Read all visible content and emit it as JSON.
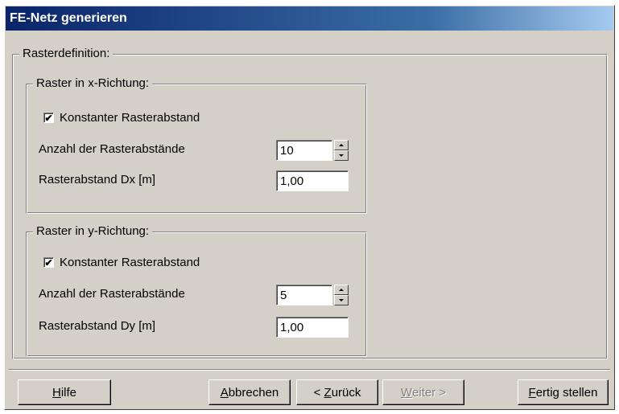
{
  "window": {
    "title": "FE-Netz generieren"
  },
  "raster": {
    "group_label": "Rasterdefinition:",
    "x": {
      "group_label": "Raster in x-Richtung:",
      "constant_checked": true,
      "constant_label": "Konstanter Rasterabstand",
      "count_label": "Anzahl der Rasterabstände",
      "count_value": "10",
      "spacing_label": "Rasterabstand  Dx [m]",
      "spacing_value": "1,00"
    },
    "y": {
      "group_label": "Raster in y-Richtung:",
      "constant_checked": true,
      "constant_label": "Konstanter Rasterabstand",
      "count_label": "Anzahl der Rasterabstände",
      "count_value": "5",
      "spacing_label": "Rasterabstand  Dy [m]",
      "spacing_value": "1,00"
    }
  },
  "buttons": {
    "help": {
      "mnemonic": "H",
      "rest": "ilfe"
    },
    "cancel": {
      "mnemonic": "A",
      "rest": "bbrechen"
    },
    "back": {
      "prefix": "< ",
      "mnemonic": "Z",
      "rest": "urück"
    },
    "next": {
      "mnemonic": "W",
      "rest": "eiter >",
      "disabled": true
    },
    "finish": {
      "mnemonic": "F",
      "rest": "ertig stellen"
    }
  },
  "check_mark": "✔"
}
